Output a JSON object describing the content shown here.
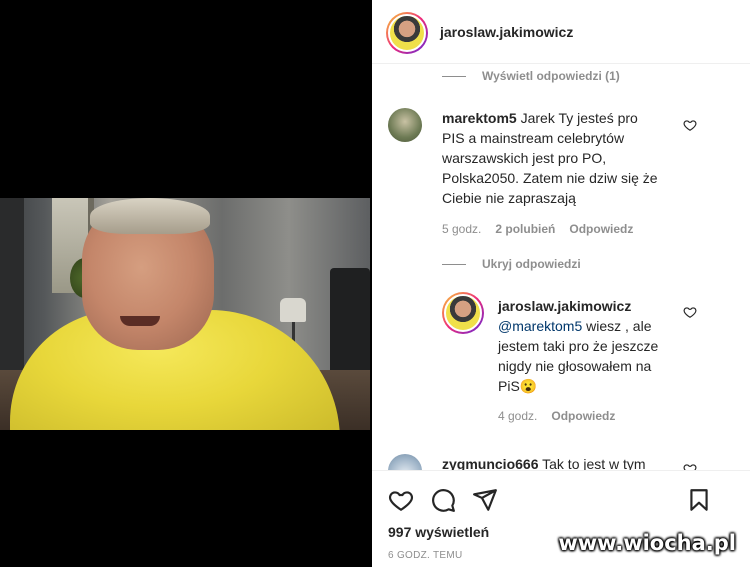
{
  "post": {
    "author": "jaroslaw.jakimowicz",
    "views": "997 wyświetleń",
    "time_ago": "6 GODZ. TEMU"
  },
  "comments": {
    "view_replies_top": "Wyświetl odpowiedzi (1)",
    "hide_replies": "Ukryj odpowiedzi",
    "items": [
      {
        "username": "marektom5",
        "text": "Jarek Ty jesteś pro PIS a mainstream celebrytów warszawskich jest pro PO, Polska2050. Zatem nie dziw się że Ciebie nie zapraszają",
        "line1": "Jarek Ty jesteś pro",
        "line2": "PIS a mainstream celebrytów",
        "line3": "warszawskich jest pro PO,",
        "line4": "Polska2050. Zatem nie dziw się że",
        "line5": "Ciebie nie zapraszają",
        "time": "5 godz.",
        "likes": "2 polubień",
        "reply": "Odpowiedz"
      },
      {
        "username": "jaroslaw.jakimowicz",
        "mention": "@marektom5",
        "line1": "wiesz , ale",
        "line2": "jestem taki pro że jeszcze",
        "line3": "nigdy nie głosowałem na",
        "line4": "PiS😮",
        "time": "4 godz.",
        "reply": "Odpowiedz"
      },
      {
        "username": "zygmuncio666",
        "line1": "Tak to jest w tym"
      }
    ]
  },
  "actions": {
    "like": "heart-icon",
    "comment": "comment-icon",
    "share": "share-icon",
    "save": "bookmark-icon"
  },
  "watermark": "www.wiocha.pl",
  "colors": {
    "accent_link": "#00376b",
    "muted": "#8e8e8e",
    "text": "#262626"
  }
}
